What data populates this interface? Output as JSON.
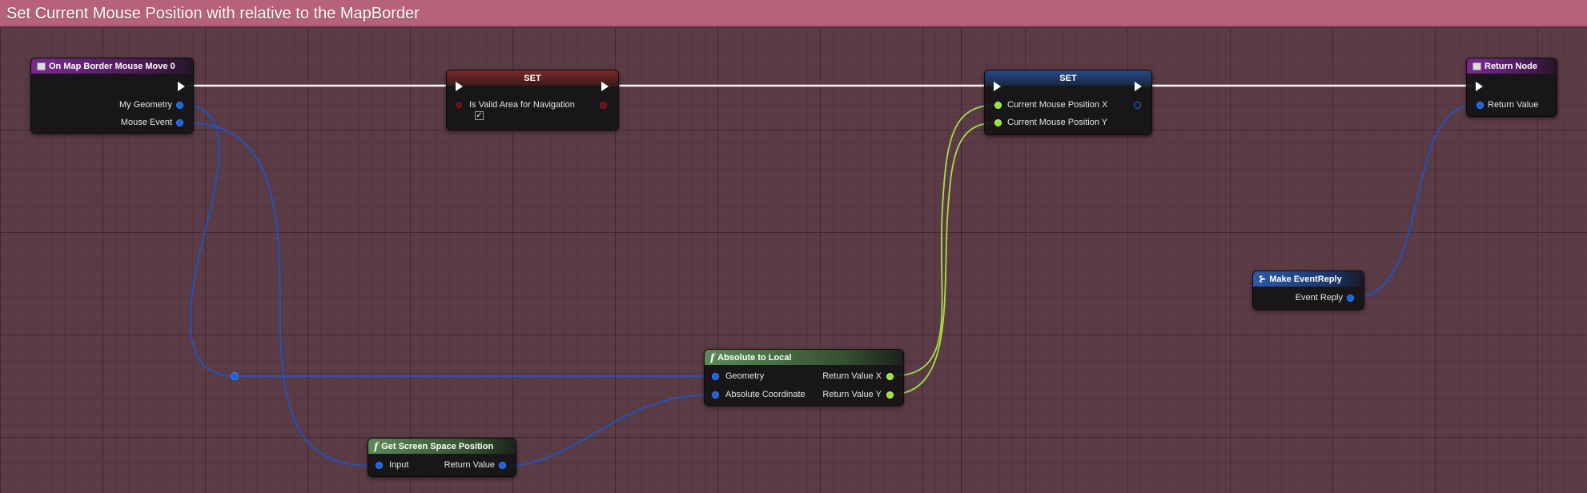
{
  "comment": {
    "title": "Set Current Mouse Position with relative to the MapBorder"
  },
  "nodes": {
    "event": {
      "title": "On Map Border Mouse Move 0",
      "pins": {
        "geometry": "My Geometry",
        "mouse_event": "Mouse Event"
      }
    },
    "set_valid": {
      "title": "SET",
      "pins": {
        "valid": "Is Valid Area for Navigation"
      },
      "checked": "✓"
    },
    "set_mouse": {
      "title": "SET",
      "pins": {
        "x": "Current Mouse Position X",
        "y": "Current Mouse Position Y"
      }
    },
    "return": {
      "title": "Return Node",
      "pins": {
        "return_value": "Return Value"
      }
    },
    "make_reply": {
      "title": "Make EventReply",
      "pins": {
        "event_reply": "Event Reply"
      }
    },
    "abs_to_local": {
      "title": "Absolute to Local",
      "pins": {
        "geometry": "Geometry",
        "abs_coord": "Absolute Coordinate",
        "ret_x": "Return Value X",
        "ret_y": "Return Value Y"
      }
    },
    "screen_space": {
      "title": "Get Screen Space Position",
      "pins": {
        "input": "Input",
        "return_value": "Return Value"
      }
    }
  },
  "icons": {
    "function": "f",
    "struct": "⊱"
  },
  "colors": {
    "exec_wire": "#ffffff",
    "struct_wire": "#1a57c8",
    "float_wire": "#a7e048",
    "comment": "#b6627a"
  }
}
